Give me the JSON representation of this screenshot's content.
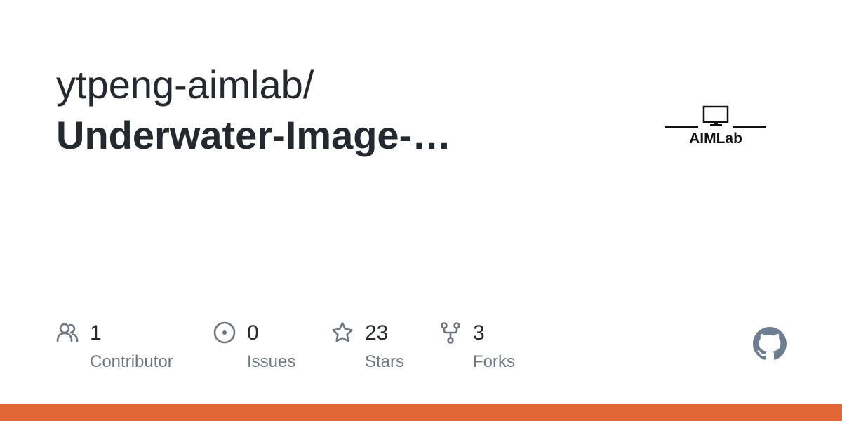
{
  "header": {
    "owner": "ytpeng-aimlab/",
    "repo_name": "Underwater-Image-…"
  },
  "logo": {
    "text": "AIMLab",
    "icon": "monitor-icon"
  },
  "stats": {
    "contributors": {
      "count": "1",
      "label": "Contributor",
      "icon": "people-icon"
    },
    "issues": {
      "count": "0",
      "label": "Issues",
      "icon": "issue-opened-icon"
    },
    "stars": {
      "count": "23",
      "label": "Stars",
      "icon": "star-icon"
    },
    "forks": {
      "count": "3",
      "label": "Forks",
      "icon": "repo-forked-icon"
    }
  },
  "brand": {
    "icon": "github-mark-icon"
  },
  "colors": {
    "text": "#24292f",
    "muted": "#6e7781",
    "github_mark": "#6e7d91",
    "language_bar": "#e16737"
  }
}
